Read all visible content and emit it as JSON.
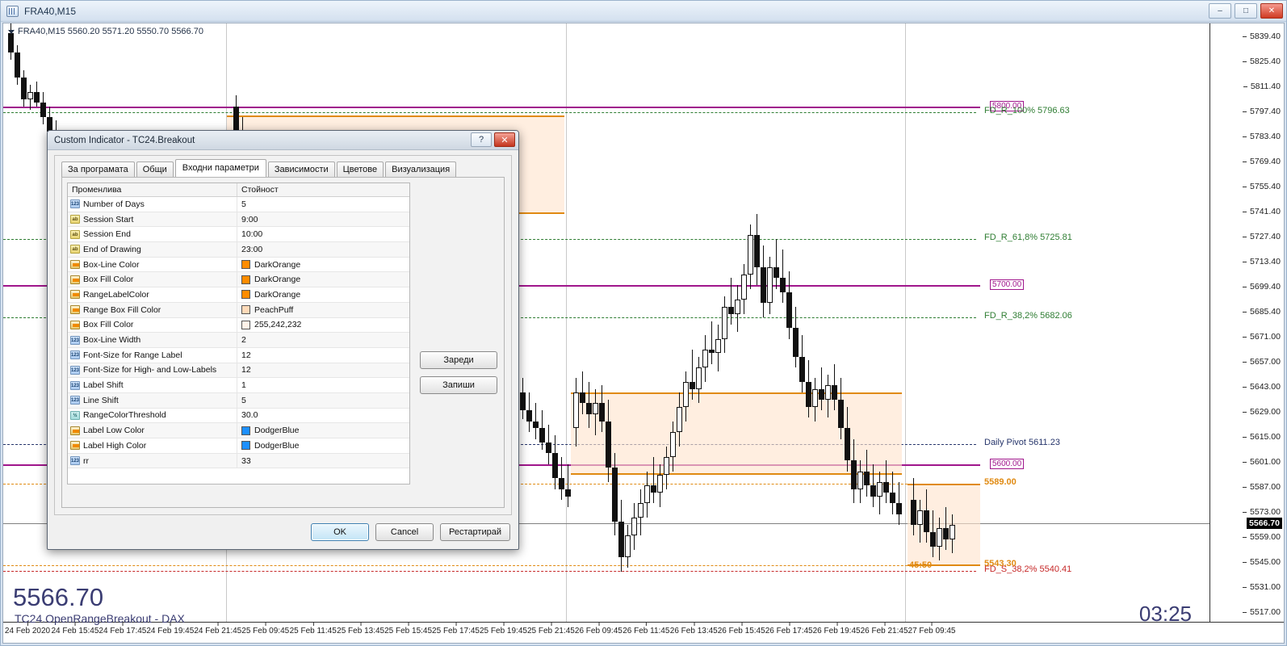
{
  "window": {
    "title": "FRA40,M15",
    "icon": "chart-window-icon",
    "controls": {
      "minimize": "–",
      "maximize": "□",
      "close": "✕"
    }
  },
  "chart": {
    "ohlc_header": "FRA40,M15  5560.20 5571.20 5550.70 5566.70",
    "symbol": "FRA40",
    "timeframe": "M15",
    "open": "5560.20",
    "high": "5571.20",
    "low": "5550.70",
    "close": "5566.70",
    "big_price": "5566.70",
    "subtitle": "TC24.OpenRangeBreakout - DAX",
    "countdown": "03:25",
    "range_timer_label": "45:50",
    "current_price_tag": "5566.70",
    "price_axis": [
      "5839.40",
      "5825.40",
      "5811.40",
      "5797.40",
      "5783.40",
      "5769.40",
      "5755.40",
      "5741.40",
      "5727.40",
      "5713.40",
      "5699.40",
      "5685.40",
      "5671.00",
      "5657.00",
      "5643.00",
      "5629.00",
      "5615.00",
      "5601.00",
      "5587.00",
      "5573.00",
      "5559.00",
      "5545.00",
      "5531.00",
      "5517.00"
    ],
    "time_axis": [
      "24 Feb 2020",
      "24 Feb 15:45",
      "24 Feb 17:45",
      "24 Feb 19:45",
      "24 Feb 21:45",
      "25 Feb 09:45",
      "25 Feb 11:45",
      "25 Feb 13:45",
      "25 Feb 15:45",
      "25 Feb 17:45",
      "25 Feb 19:45",
      "25 Feb 21:45",
      "26 Feb 09:45",
      "26 Feb 11:45",
      "26 Feb 13:45",
      "26 Feb 15:45",
      "26 Feb 17:45",
      "26 Feb 19:45",
      "26 Feb 21:45",
      "27 Feb 09:45"
    ],
    "price_boxes": [
      {
        "label": "5800.00",
        "price": 5800
      },
      {
        "label": "5700.00",
        "price": 5700
      },
      {
        "label": "5600.00",
        "price": 5600
      }
    ],
    "level_labels": [
      {
        "text": "FD_R_100% 5796.63",
        "price": 5796.63,
        "color": "#2e7d32"
      },
      {
        "text": "FD_R_61,8% 5725.81",
        "price": 5725.81,
        "color": "#2e7d32"
      },
      {
        "text": "FD_R_38,2% 5682.06",
        "price": 5682.06,
        "color": "#2e7d32"
      },
      {
        "text": "Daily Pivot 5611.23",
        "price": 5611.23,
        "color": "#26356b"
      },
      {
        "text": "5589.00",
        "price": 5589.0,
        "color": "#e08a12"
      },
      {
        "text": "FD_S_38,2% 5540.41",
        "price": 5540.41,
        "color": "#c62828"
      },
      {
        "text": "5543.30",
        "price": 5543.3,
        "color": "#e08a12"
      }
    ],
    "colors": {
      "magenta_line": "#a0168c",
      "green_level": "#2e7d32",
      "red_level": "#c62828",
      "navy_level": "#26356b",
      "box_border": "#e08a12",
      "box_fill": "#ffe4cd",
      "current_price_line": "#808080"
    }
  },
  "dialog": {
    "title": "Custom Indicator - TC24.Breakout",
    "help_button": "?",
    "close_button": "✕",
    "tabs": [
      {
        "label": "За програмата",
        "active": false
      },
      {
        "label": "Общи",
        "active": false
      },
      {
        "label": "Входни параметри",
        "active": true
      },
      {
        "label": "Зависимости",
        "active": false
      },
      {
        "label": "Цветове",
        "active": false
      },
      {
        "label": "Визуализация",
        "active": false
      }
    ],
    "grid": {
      "columns": [
        "Променлива",
        "Стойност"
      ],
      "rows": [
        {
          "type": "int",
          "name": "Number of Days",
          "value": "5"
        },
        {
          "type": "str",
          "name": "Session Start",
          "value": "9:00"
        },
        {
          "type": "str",
          "name": "Session End",
          "value": "10:00"
        },
        {
          "type": "str",
          "name": "End of Drawing",
          "value": "23:00"
        },
        {
          "type": "color",
          "name": "Box-Line Color",
          "value": "DarkOrange",
          "swatch": "#ff8c00"
        },
        {
          "type": "color",
          "name": "Box Fill Color",
          "value": "DarkOrange",
          "swatch": "#ff8c00"
        },
        {
          "type": "color",
          "name": "RangeLabelColor",
          "value": "DarkOrange",
          "swatch": "#ff8c00"
        },
        {
          "type": "color",
          "name": "Range Box Fill Color",
          "value": "PeachPuff",
          "swatch": "#ffdab9"
        },
        {
          "type": "color",
          "name": "Box Fill Color",
          "value": "255,242,232",
          "swatch": "#fff2e8"
        },
        {
          "type": "int",
          "name": "Box-Line Width",
          "value": "2"
        },
        {
          "type": "int",
          "name": "Font-Size for Range Label",
          "value": "12"
        },
        {
          "type": "int",
          "name": "Font-Size for High- and Low-Labels",
          "value": "12"
        },
        {
          "type": "int",
          "name": "Label Shift",
          "value": "1"
        },
        {
          "type": "int",
          "name": "Line Shift",
          "value": "5"
        },
        {
          "type": "float",
          "name": "RangeColorThreshold",
          "value": "30.0"
        },
        {
          "type": "color",
          "name": "Label Low Color",
          "value": "DodgerBlue",
          "swatch": "#1e90ff"
        },
        {
          "type": "color",
          "name": "Label High Color",
          "value": "DodgerBlue",
          "swatch": "#1e90ff"
        },
        {
          "type": "int",
          "name": "rr",
          "value": "33"
        }
      ]
    },
    "side_buttons": [
      {
        "label": "Зареди"
      },
      {
        "label": "Запиши"
      }
    ],
    "footer_buttons": [
      {
        "label": "OK",
        "primary": true
      },
      {
        "label": "Cancel",
        "primary": false
      },
      {
        "label": "Рестартирай",
        "primary": false
      }
    ]
  }
}
